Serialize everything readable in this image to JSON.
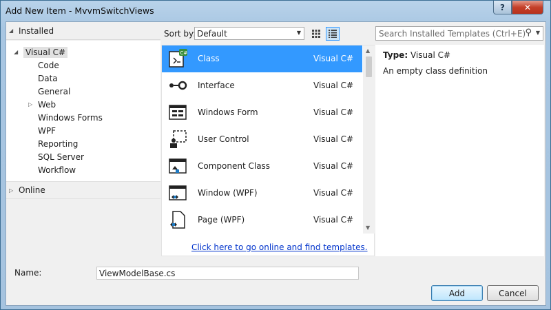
{
  "window": {
    "title": "Add New Item - MvvmSwitchViews",
    "help_label": "?",
    "close_label": "✕"
  },
  "tree": {
    "installed_label": "Installed",
    "root_label": "Visual C#",
    "children": [
      "Code",
      "Data",
      "General",
      "Web",
      "Windows Forms",
      "WPF",
      "Reporting",
      "SQL Server",
      "Workflow"
    ],
    "online_label": "Online"
  },
  "sort": {
    "label": "Sort by:",
    "value": "Default"
  },
  "templates": [
    {
      "name": "Class",
      "lang": "Visual C#",
      "icon": "class-icon"
    },
    {
      "name": "Interface",
      "lang": "Visual C#",
      "icon": "interface-icon"
    },
    {
      "name": "Windows Form",
      "lang": "Visual C#",
      "icon": "windows-form-icon"
    },
    {
      "name": "User Control",
      "lang": "Visual C#",
      "icon": "user-control-icon"
    },
    {
      "name": "Component Class",
      "lang": "Visual C#",
      "icon": "component-class-icon"
    },
    {
      "name": "Window (WPF)",
      "lang": "Visual C#",
      "icon": "wpf-window-icon"
    },
    {
      "name": "Page (WPF)",
      "lang": "Visual C#",
      "icon": "wpf-page-icon"
    }
  ],
  "online_link": "Click here to go online and find templates.",
  "search": {
    "placeholder": "Search Installed Templates (Ctrl+E)"
  },
  "detail": {
    "type_label": "Type:",
    "type_value": "Visual C#",
    "description": "An empty class definition"
  },
  "name_field": {
    "label": "Name:",
    "value": "ViewModelBase.cs"
  },
  "buttons": {
    "add": "Add",
    "cancel": "Cancel"
  },
  "colors": {
    "selection": "#3399ff",
    "link": "#0033cc"
  }
}
